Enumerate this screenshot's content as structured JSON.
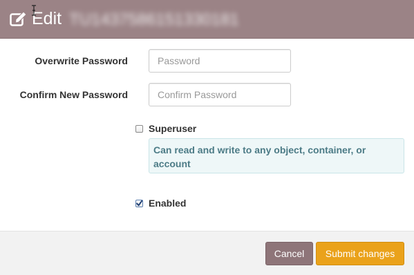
{
  "header": {
    "title": "Edit",
    "subject": "TU1437586151330181",
    "edit_icon": "edit-pencil-icon",
    "cursor_icon": "text-cursor-icon"
  },
  "form": {
    "overwrite_password_label": "Overwrite Password",
    "overwrite_password_placeholder": "Password",
    "overwrite_password_value": "",
    "confirm_password_label": "Confirm New Password",
    "confirm_password_placeholder": "Confirm Password",
    "confirm_password_value": "",
    "superuser_label": "Superuser",
    "superuser_checked": false,
    "superuser_help": "Can read and write to any object, container, or account",
    "enabled_label": "Enabled",
    "enabled_checked": true
  },
  "footer": {
    "cancel_label": "Cancel",
    "submit_label": "Submit changes"
  },
  "colors": {
    "header_bg": "#9b8386",
    "cancel_bg": "#8e7579",
    "submit_bg": "#eaa21b",
    "help_bg": "#eef7f8",
    "help_text": "#4c7b86"
  }
}
